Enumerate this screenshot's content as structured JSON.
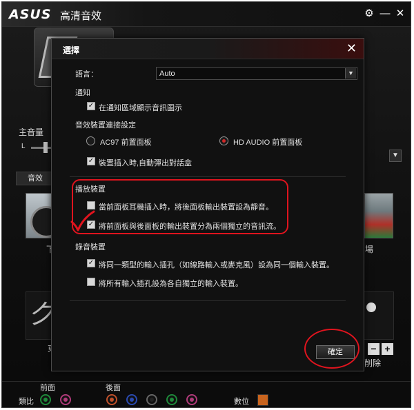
{
  "app": {
    "logo_text": "ASUS",
    "title": "高清音效",
    "icons": {
      "settings": "gear-icon",
      "minimize": "minimize-icon",
      "close": "close-icon"
    }
  },
  "background": {
    "master_volume_label": "主音量",
    "volume_l_label": "L",
    "tab_label": "音效",
    "left_card_caption": "下",
    "right_card_caption": "場",
    "left_panel_glyph": "ク",
    "left_panel_caption": "東",
    "right_panel_caption": "削除",
    "minus_label": "−",
    "plus_label": "+"
  },
  "bottombar": {
    "front_label": "前面",
    "back_label": "後面",
    "analog_label": "類比",
    "digital_label": "數位",
    "front_jacks": [
      "green",
      "pink"
    ],
    "back_jacks": [
      "orange",
      "blue",
      "black",
      "green",
      "pink"
    ]
  },
  "dialog": {
    "title": "選擇",
    "close_glyph": "✕",
    "language_label": "語言：",
    "language_value": "Auto",
    "notification_header": "通知",
    "notification_option": {
      "label": "在通知區域顯示音訊圖示",
      "checked": true
    },
    "connection_header": "音效裝置連接設定",
    "radio_ac97": {
      "label": "AC97 前置面板",
      "selected": false
    },
    "radio_hdaudio": {
      "label": "HD AUDIO 前置面板",
      "selected": true
    },
    "popup_option": {
      "label": "裝置插入時,自動彈出對話盒",
      "checked": true
    },
    "playback_header": "播放裝置",
    "playback_option_1": {
      "label": "當前面板耳機插入時，將後面板輸出裝置設為靜音。",
      "checked": false
    },
    "playback_option_2": {
      "label": "將前面板與後面板的輸出裝置分為兩個獨立的音訊流。",
      "checked": true
    },
    "recording_header": "錄音裝置",
    "recording_option_1": {
      "label": "將同一類型的輸入插孔（如線路輸入或麥克風）設為同一個輸入裝置。",
      "checked": true
    },
    "recording_option_2": {
      "label": "將所有輸入插孔設為各自獨立的輸入裝置。",
      "checked": false
    },
    "ok_label": "確定",
    "check_glyph": "✓"
  },
  "annotations": {
    "color": "#e0141e"
  }
}
